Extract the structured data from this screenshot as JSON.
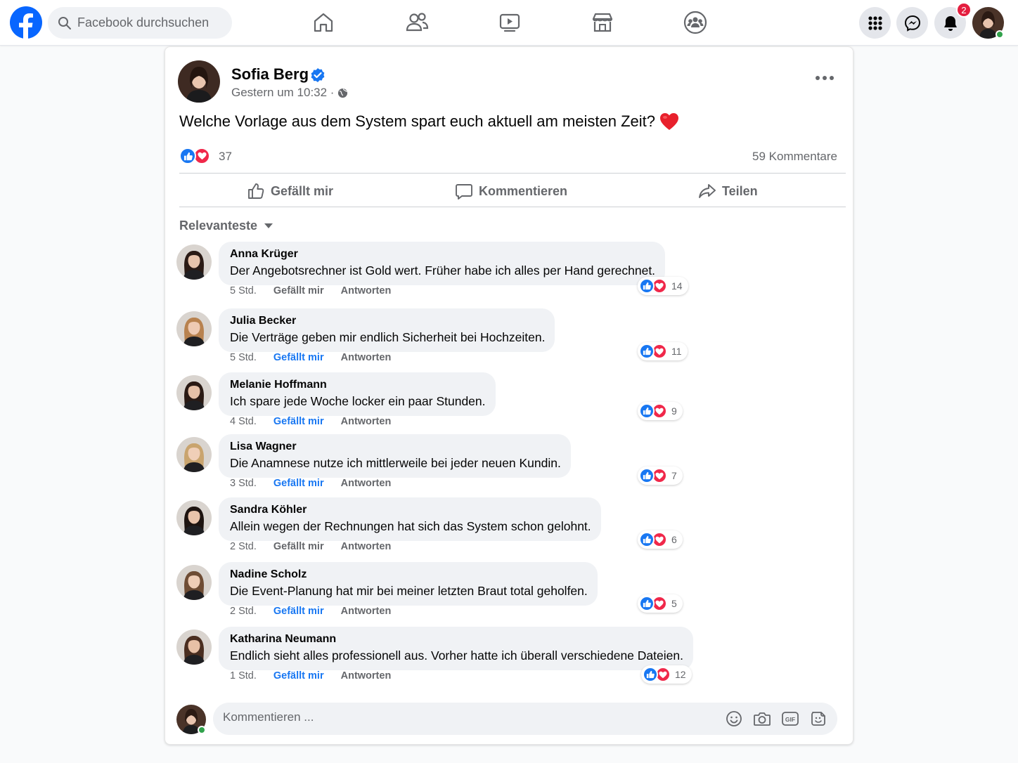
{
  "colors": {
    "brand": "#0866ff",
    "like": "#1877f2",
    "love": "#f0284a",
    "badge": "#e41e3f",
    "online": "#31a24c"
  },
  "topbar": {
    "search_placeholder": "Facebook durchsuchen",
    "nav_icons": [
      "home-icon",
      "friends-icon",
      "video-icon",
      "marketplace-icon",
      "groups-icon"
    ],
    "right_icons": [
      "menu-grid-icon",
      "messenger-icon",
      "notifications-icon"
    ],
    "notification_count": "2"
  },
  "post": {
    "author": "Sofia Berg",
    "verified": true,
    "timestamp": "Gestern um 10:32 ·",
    "privacy_icon": "globe-icon",
    "text": "Welche Vorlage aus dem System spart euch aktuell am meisten Zeit?",
    "emoji": "❤️",
    "reaction_count": "37",
    "comment_count": "59 Kommentare",
    "actions": {
      "like": "Gefällt mir",
      "comment": "Kommentieren",
      "share": "Teilen"
    },
    "sort_label": "Relevanteste"
  },
  "comments": [
    {
      "name": "Anna Krüger",
      "text": "Der Angebotsrechner ist Gold wert. Früher habe ich alles per Hand gerechnet.",
      "time": "5 Std.",
      "like": "Gefällt mir",
      "liked": false,
      "reply": "Antworten",
      "reactions": "14"
    },
    {
      "name": "Julia Becker",
      "text": "Die Verträge geben mir endlich Sicherheit bei Hochzeiten.",
      "time": "5 Std.",
      "like": "Gefällt mir",
      "liked": true,
      "reply": "Antworten",
      "reactions": "11"
    },
    {
      "name": "Melanie Hoffmann",
      "text": "Ich spare jede Woche locker ein paar Stunden.",
      "time": "4 Std.",
      "like": "Gefällt mir",
      "liked": true,
      "reply": "Antworten",
      "reactions": "9"
    },
    {
      "name": "Lisa Wagner",
      "text": "Die Anamnese nutze ich mittlerweile bei jeder neuen Kundin.",
      "time": "3 Std.",
      "like": "Gefällt mir",
      "liked": true,
      "reply": "Antworten",
      "reactions": "7"
    },
    {
      "name": "Sandra Köhler",
      "text": "Allein wegen der Rechnungen hat sich das System schon gelohnt.",
      "time": "2 Std.",
      "like": "Gefällt mir",
      "liked": false,
      "reply": "Antworten",
      "reactions": "6"
    },
    {
      "name": "Nadine Scholz",
      "text": "Die Event-Planung hat mir bei meiner letzten Braut total geholfen.",
      "time": "2 Std.",
      "like": "Gefällt mir",
      "liked": true,
      "reply": "Antworten",
      "reactions": "5"
    },
    {
      "name": "Katharina Neumann",
      "text": "Endlich sieht alles professionell aus. Vorher hatte ich überall verschiedene Dateien.",
      "time": "1 Std.",
      "like": "Gefällt mir",
      "liked": true,
      "reply": "Antworten",
      "reactions": "12"
    }
  ],
  "composer": {
    "placeholder": "Kommentieren ...",
    "icons": [
      "emoji-icon",
      "camera-icon",
      "gif-icon",
      "sticker-icon"
    ]
  }
}
